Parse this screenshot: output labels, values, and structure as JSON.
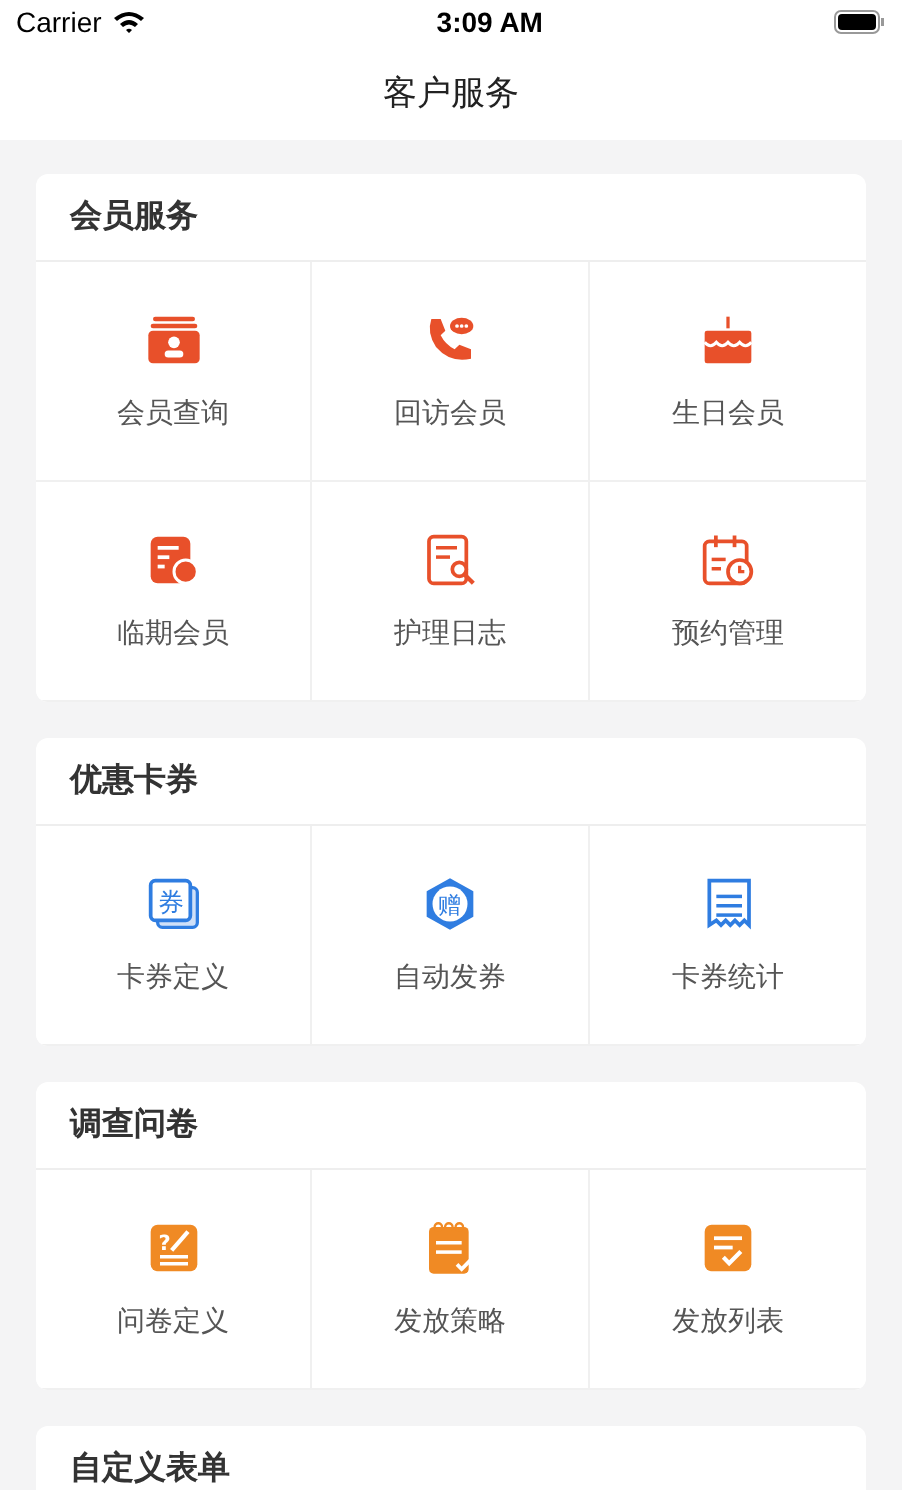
{
  "status_bar": {
    "carrier": "Carrier",
    "time": "3:09 AM"
  },
  "nav": {
    "title": "客户服务"
  },
  "sections": [
    {
      "title": "会员服务",
      "color": "#e8502a",
      "items": [
        {
          "label": "会员查询"
        },
        {
          "label": "回访会员"
        },
        {
          "label": "生日会员"
        },
        {
          "label": "临期会员"
        },
        {
          "label": "护理日志"
        },
        {
          "label": "预约管理"
        }
      ]
    },
    {
      "title": "优惠卡券",
      "color": "#2f7de1",
      "items": [
        {
          "label": "卡券定义",
          "icon_text": "券"
        },
        {
          "label": "自动发券",
          "icon_text": "赠"
        },
        {
          "label": "卡券统计"
        }
      ]
    },
    {
      "title": "调查问卷",
      "color": "#f08a24",
      "items": [
        {
          "label": "问卷定义",
          "icon_text": "?"
        },
        {
          "label": "发放策略"
        },
        {
          "label": "发放列表"
        }
      ]
    },
    {
      "title": "自定义表单"
    }
  ]
}
